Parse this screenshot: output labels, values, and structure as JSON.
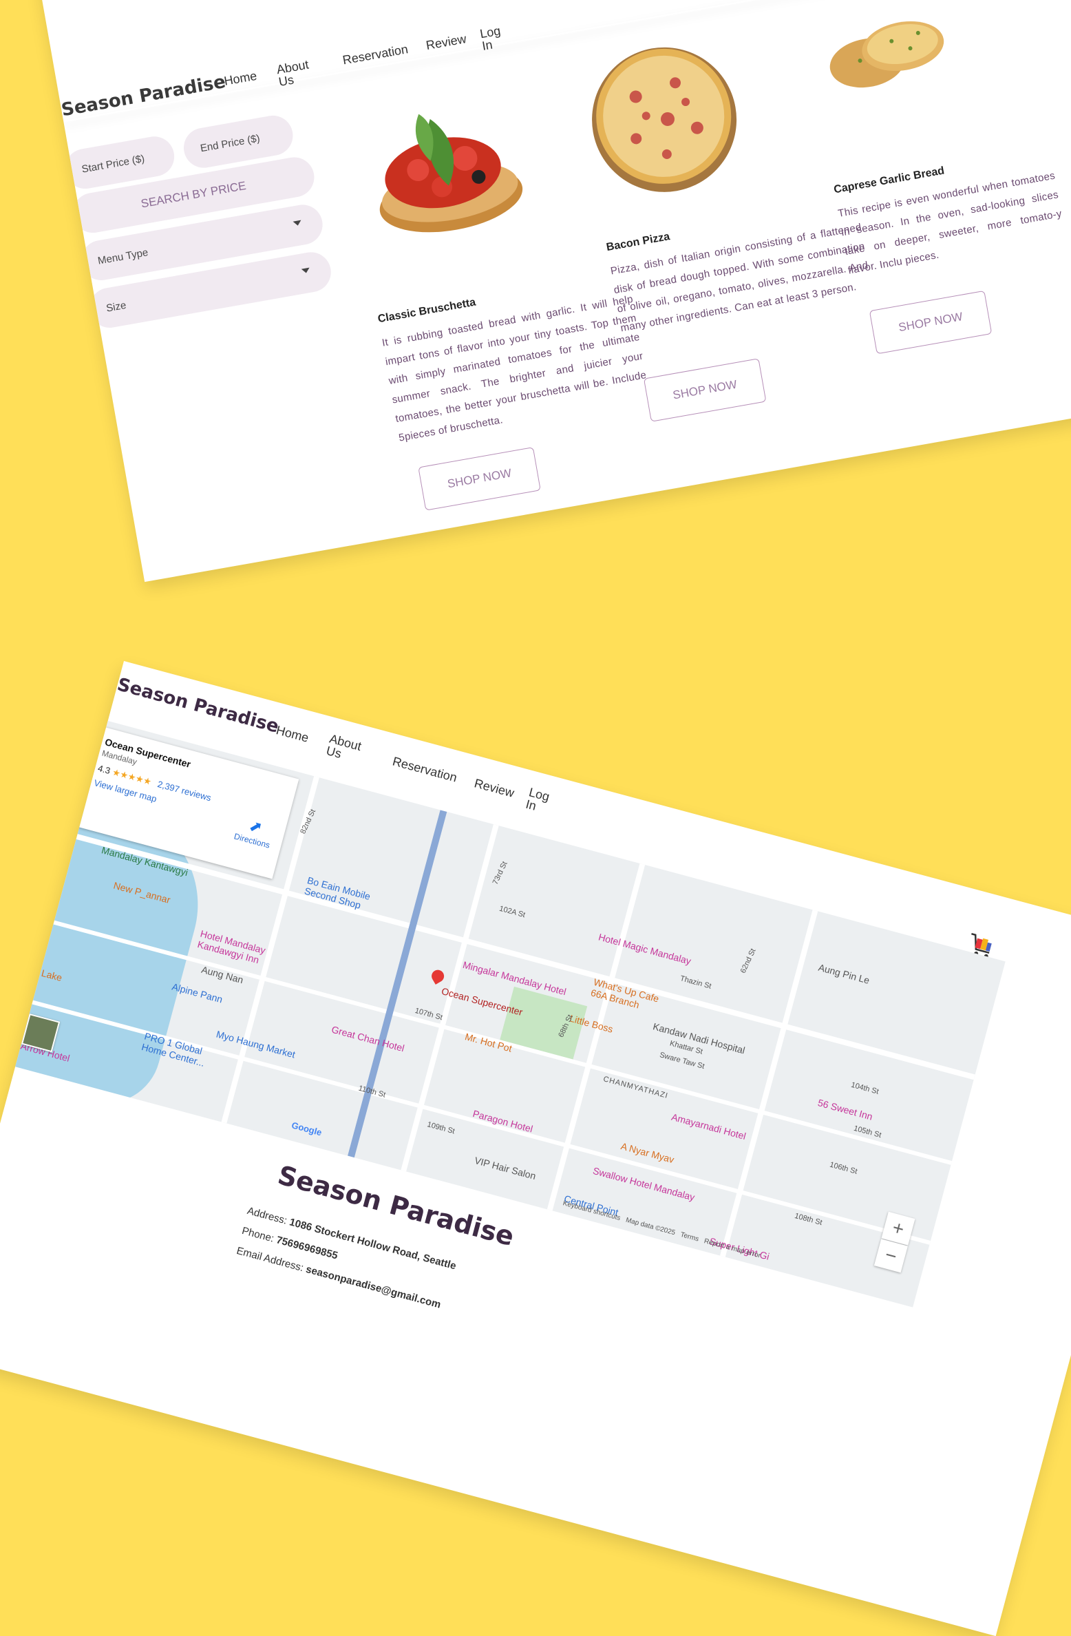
{
  "menu_page": {
    "brand": "Season Paradise",
    "nav": [
      "Home",
      "About Us",
      "Reservation",
      "Review",
      "Log In"
    ],
    "filters": {
      "start_price_placeholder": "Start Price ($)",
      "end_price_placeholder": "End Price ($)",
      "search_button": "SEARCH BY PRICE",
      "menu_type_placeholder": "Menu Type",
      "size_placeholder": "Size"
    },
    "products": [
      {
        "title": "Classic Bruschetta",
        "description": "It is rubbing toasted bread with garlic. It will help impart tons of flavor into your tiny toasts. Top them with simply marinated tomatoes for the ultimate summer snack. The brighter and juicier your tomatoes, the better your bruschetta will be. Include 5pieces of bruschetta.",
        "button": "SHOP NOW"
      },
      {
        "title": "Bacon Pizza",
        "description": "Pizza, dish of Italian origin consisting of a flattened disk of bread dough topped. With some combination of olive oil, oregano, tomato, olives, mozzarella. And many other ingredients. Can eat at least 3 person.",
        "button": "SHOP NOW"
      },
      {
        "title": "Caprese Garlic Bread",
        "description": "This recipe is even wonderful when tomatoes in season. In the oven, sad-looking slices take on deeper, sweeter, more tomato-y flavor. Inclu pieces.",
        "button": "SHOP NOW"
      }
    ]
  },
  "location_page": {
    "brand": "Season Paradise",
    "nav": [
      "Home",
      "About Us",
      "Reservation",
      "Review",
      "Log In"
    ],
    "map": {
      "place_name": "Ocean Supercenter",
      "place_city": "Mandalay",
      "rating": "4.3",
      "reviews": "2,397 reviews",
      "larger_map": "View larger map",
      "directions": "Directions",
      "attribution_keyboard": "Keyboard shortcuts",
      "attribution_data": "Map data ©2025",
      "attribution_terms": "Terms",
      "attribution_report": "Report a map error",
      "google": "Google",
      "labels": {
        "bo_eain": "Bo Eain Mobile Second Shop",
        "kantawgyi": "Mandalay Kantawgyi",
        "new_pannar": "New P_annar",
        "hotel_mandalay": "Hotel Mandalay Kandawgyi Inn",
        "aung_nan": "Aung Nan",
        "alpine": "Alpine Pann",
        "myo_haung": "Myo Haung Market",
        "pro1": "PRO 1 Global Home Center...",
        "arrow": "Arrow Hotel",
        "lake": "val Lake",
        "mingalar": "Mingalar Mandalay Hotel",
        "ocean_pin": "Ocean Supercenter",
        "hot_pot": "Mr. Hot Pot",
        "great_chan": "Great Chan Hotel",
        "paragon": "Paragon Hotel",
        "hotel_magic": "Hotel Magic Mandalay",
        "whats_up": "What's Up Cafe 66A Branch",
        "little_boss": "Little Boss",
        "kandaw_nadi": "Kandaw Nadi Hospital",
        "chanmyathazi": "CHANMYATHAZI",
        "amayarnadi": "Amayarnadi Hotel",
        "a_nyar": "A Nyar Myav",
        "swallow": "Swallow Hotel Mandalay",
        "sweet_inn": "56 Sweet Inn",
        "vip": "VIP Hair Salon",
        "central": "Central Point",
        "super_light": "Super Light Gi",
        "aung_pin": "Aung Pin Le",
        "st_73": "73rd St",
        "st_68": "68th St",
        "st_62": "62nd St",
        "st_82": "82nd St",
        "st_102a": "102A St",
        "st_107": "107th St",
        "st_110": "110th St",
        "st_109": "109th St",
        "st_104": "104th St",
        "st_105": "105th St",
        "st_106": "106th St",
        "st_108": "108th St",
        "thazin": "Thazin St",
        "khattar": "Khattar St",
        "sware": "Sware Taw St"
      }
    },
    "footer": {
      "brand": "Season Paradise",
      "address_label": "Address:",
      "address_value": "1086 Stockert Hollow Road, Seattle",
      "phone_label": "Phone:",
      "phone_value": "75696969855",
      "email_label": "Email Address:",
      "email_value": "seasonparadise@gmail.com"
    }
  },
  "colors": {
    "background": "#ffdf58",
    "accent_purple": "#7a5a80",
    "hotel_pink": "#c5369a",
    "food_orange": "#d76f21"
  },
  "icons": [
    "shopping-cart-icon",
    "search-icon",
    "map-pin-icon",
    "directions-icon",
    "star-icon"
  ]
}
